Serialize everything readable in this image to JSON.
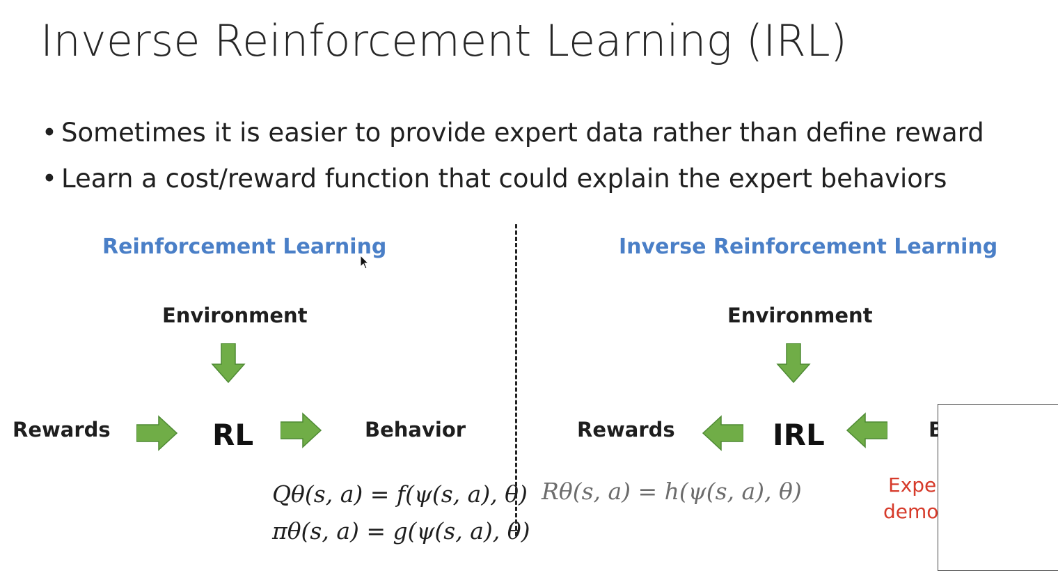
{
  "title": "Inverse Reinforcement Learning (IRL)",
  "bullets": [
    "Sometimes it is easier to provide expert data rather than define reward",
    "Learn a cost/reward function that could explain the expert behaviors"
  ],
  "bullet_symbol": "•",
  "rl_panel": {
    "heading": "Reinforcement Learning",
    "environment": "Environment",
    "rewards": "Rewards",
    "center": "RL",
    "behavior": "Behavior",
    "eq_q": "Qθ(s, a) = f(ψ(s, a), θ)",
    "eq_pi": "πθ(s, a) = g(ψ(s, a), θ)"
  },
  "irl_panel": {
    "heading": "Inverse Reinforcement Learning",
    "environment": "Environment",
    "rewards": "Rewards",
    "center": "IRL",
    "behavior_partial": "B",
    "eq_r": "Rθ(s, a) = h(ψ(s, a), θ)",
    "expert_partial_1": "Exper",
    "expert_partial_2": "demo"
  },
  "colors": {
    "heading_blue": "#4a7fc7",
    "arrow_green": "#70ad47",
    "arrow_stroke": "#4e8a34",
    "expert_red": "#d63a2a"
  },
  "icons": {
    "arrow_down": "green-arrow-down-icon",
    "arrow_right": "green-arrow-right-icon",
    "arrow_left": "green-arrow-left-icon",
    "cursor": "mouse-pointer-icon"
  }
}
